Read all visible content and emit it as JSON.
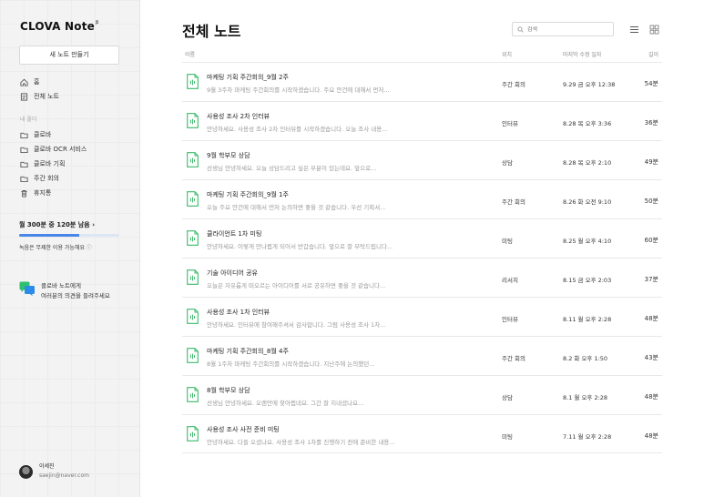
{
  "app": {
    "logo": "CLOVA Note",
    "logo_mark": "β"
  },
  "sidebar": {
    "new_note": "새 노트 만들기",
    "nav": [
      {
        "label": "홈",
        "icon": "home-icon"
      },
      {
        "label": "전체 노트",
        "icon": "notes-icon"
      }
    ],
    "folders_label": "내 폴더",
    "folders": [
      {
        "label": "클로바",
        "icon": "folder-icon"
      },
      {
        "label": "클로바 OCR 서비스",
        "icon": "folder-icon"
      },
      {
        "label": "클로바 기획",
        "icon": "folder-icon"
      },
      {
        "label": "주간 회의",
        "icon": "folder-icon"
      },
      {
        "label": "휴지통",
        "icon": "trash-icon"
      }
    ],
    "usage": {
      "label": "월 300분 중 120분 남음",
      "fraction_used": 0.6
    },
    "usage_note": "녹음은 무제한 이용 가능해요",
    "feedback": {
      "line1": "클로바 노트에게",
      "line2": "여러분의 의견을 들려주세요"
    },
    "profile": {
      "name": "이세진",
      "email": "saejin@naver.com"
    }
  },
  "main": {
    "title": "전체 노트",
    "search_placeholder": "검색",
    "columns": {
      "name": "이름",
      "location": "위치",
      "modified": "마지막 수정 일자",
      "length": "길이"
    },
    "notes": [
      {
        "title": "마케팅 기획 주간회의_9월 2주",
        "preview": "9월 3주차 마케팅 주간회의를 시작하겠습니다. 주요 안건에 대해서 먼저...",
        "location": "주간 회의",
        "date": "9.29 금 오후 12:38",
        "length": "54분"
      },
      {
        "title": "사용성 조사 2차 인터뷰",
        "preview": "안녕하세요. 사용성 조사 2차 인터뷰를 시작하겠습니다. 오늘 조사 내용...",
        "location": "인터뷰",
        "date": "8.28 목 오후 3:36",
        "length": "36분"
      },
      {
        "title": "9월 학부모 상담",
        "preview": "선생님 안녕하세요. 오늘 상담드리고 싶은 부분이 있는데요. 앞으로...",
        "location": "상담",
        "date": "8.28 목 오후 2:10",
        "length": "49분"
      },
      {
        "title": "마케팅 기획 주간회의_9월 1주",
        "preview": "오늘 주요 안건에 대해서 먼저 논의하면 좋을 것 같습니다. 우선 기획서...",
        "location": "주간 회의",
        "date": "8.26 화 오전 9:10",
        "length": "50분"
      },
      {
        "title": "클라이언트 1차 미팅",
        "preview": "안녕하세요. 이렇게 만나뵙게 되어서 반갑습니다. 앞으로 잘 부탁드립니다...",
        "location": "미팅",
        "date": "8.25 월 오후 4:10",
        "length": "60분"
      },
      {
        "title": "기술 아이디어 공유",
        "preview": "오늘은 자유롭게 떠오르는 아이디어를 서로 공유하면 좋을 것 같습니다...",
        "location": "리서치",
        "date": "8.15 금 오후 2:03",
        "length": "37분"
      },
      {
        "title": "사용성 조사 1차 인터뷰",
        "preview": "안녕하세요. 인터뷰에 참여해주셔서 감사합니다. 그럼 사용성 조사 1차...",
        "location": "인터뷰",
        "date": "8.11 월 오후 2:28",
        "length": "48분"
      },
      {
        "title": "마케팅 기획 주간회의_8월 4주",
        "preview": "8월 1주차 마케팅 주간회의를 시작하겠습니다. 지난주에 논의했던...",
        "location": "주간 회의",
        "date": "8.2 화 오후 1:50",
        "length": "43분"
      },
      {
        "title": "8월 학부모 상담",
        "preview": "선생님 안녕하세요. 오랜만에 찾아뵙네요. 그간 잘 지내셨나요...",
        "location": "상담",
        "date": "8.1 월 오후 2:28",
        "length": "48분"
      },
      {
        "title": "사용성 조사 사전 준비 미팅",
        "preview": "안녕하세요. 다들 오셨나요. 사용성 조사 1차를 진행하기 전에 준비한 내용...",
        "location": "미팅",
        "date": "7.11 월 오후 2:28",
        "length": "48분"
      }
    ]
  },
  "colors": {
    "accent_green": "#3dba6a",
    "accent_blue": "#4a86e8"
  }
}
